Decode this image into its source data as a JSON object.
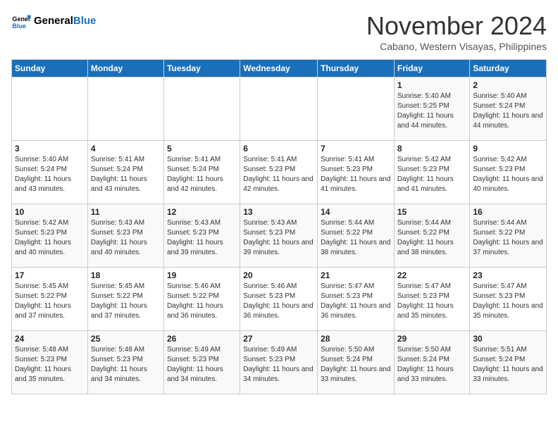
{
  "logo": {
    "line1": "General",
    "line2": "Blue"
  },
  "header": {
    "month": "November 2024",
    "location": "Cabano, Western Visayas, Philippines"
  },
  "weekdays": [
    "Sunday",
    "Monday",
    "Tuesday",
    "Wednesday",
    "Thursday",
    "Friday",
    "Saturday"
  ],
  "weeks": [
    [
      {
        "day": "",
        "info": ""
      },
      {
        "day": "",
        "info": ""
      },
      {
        "day": "",
        "info": ""
      },
      {
        "day": "",
        "info": ""
      },
      {
        "day": "",
        "info": ""
      },
      {
        "day": "1",
        "info": "Sunrise: 5:40 AM\nSunset: 5:25 PM\nDaylight: 11 hours and 44 minutes."
      },
      {
        "day": "2",
        "info": "Sunrise: 5:40 AM\nSunset: 5:24 PM\nDaylight: 11 hours and 44 minutes."
      }
    ],
    [
      {
        "day": "3",
        "info": "Sunrise: 5:40 AM\nSunset: 5:24 PM\nDaylight: 11 hours and 43 minutes."
      },
      {
        "day": "4",
        "info": "Sunrise: 5:41 AM\nSunset: 5:24 PM\nDaylight: 11 hours and 43 minutes."
      },
      {
        "day": "5",
        "info": "Sunrise: 5:41 AM\nSunset: 5:24 PM\nDaylight: 11 hours and 42 minutes."
      },
      {
        "day": "6",
        "info": "Sunrise: 5:41 AM\nSunset: 5:23 PM\nDaylight: 11 hours and 42 minutes."
      },
      {
        "day": "7",
        "info": "Sunrise: 5:41 AM\nSunset: 5:23 PM\nDaylight: 11 hours and 41 minutes."
      },
      {
        "day": "8",
        "info": "Sunrise: 5:42 AM\nSunset: 5:23 PM\nDaylight: 11 hours and 41 minutes."
      },
      {
        "day": "9",
        "info": "Sunrise: 5:42 AM\nSunset: 5:23 PM\nDaylight: 11 hours and 40 minutes."
      }
    ],
    [
      {
        "day": "10",
        "info": "Sunrise: 5:42 AM\nSunset: 5:23 PM\nDaylight: 11 hours and 40 minutes."
      },
      {
        "day": "11",
        "info": "Sunrise: 5:43 AM\nSunset: 5:23 PM\nDaylight: 11 hours and 40 minutes."
      },
      {
        "day": "12",
        "info": "Sunrise: 5:43 AM\nSunset: 5:23 PM\nDaylight: 11 hours and 39 minutes."
      },
      {
        "day": "13",
        "info": "Sunrise: 5:43 AM\nSunset: 5:23 PM\nDaylight: 11 hours and 39 minutes."
      },
      {
        "day": "14",
        "info": "Sunrise: 5:44 AM\nSunset: 5:22 PM\nDaylight: 11 hours and 38 minutes."
      },
      {
        "day": "15",
        "info": "Sunrise: 5:44 AM\nSunset: 5:22 PM\nDaylight: 11 hours and 38 minutes."
      },
      {
        "day": "16",
        "info": "Sunrise: 5:44 AM\nSunset: 5:22 PM\nDaylight: 11 hours and 37 minutes."
      }
    ],
    [
      {
        "day": "17",
        "info": "Sunrise: 5:45 AM\nSunset: 5:22 PM\nDaylight: 11 hours and 37 minutes."
      },
      {
        "day": "18",
        "info": "Sunrise: 5:45 AM\nSunset: 5:22 PM\nDaylight: 11 hours and 37 minutes."
      },
      {
        "day": "19",
        "info": "Sunrise: 5:46 AM\nSunset: 5:22 PM\nDaylight: 11 hours and 36 minutes."
      },
      {
        "day": "20",
        "info": "Sunrise: 5:46 AM\nSunset: 5:23 PM\nDaylight: 11 hours and 36 minutes."
      },
      {
        "day": "21",
        "info": "Sunrise: 5:47 AM\nSunset: 5:23 PM\nDaylight: 11 hours and 36 minutes."
      },
      {
        "day": "22",
        "info": "Sunrise: 5:47 AM\nSunset: 5:23 PM\nDaylight: 11 hours and 35 minutes."
      },
      {
        "day": "23",
        "info": "Sunrise: 5:47 AM\nSunset: 5:23 PM\nDaylight: 11 hours and 35 minutes."
      }
    ],
    [
      {
        "day": "24",
        "info": "Sunrise: 5:48 AM\nSunset: 5:23 PM\nDaylight: 11 hours and 35 minutes."
      },
      {
        "day": "25",
        "info": "Sunrise: 5:48 AM\nSunset: 5:23 PM\nDaylight: 11 hours and 34 minutes."
      },
      {
        "day": "26",
        "info": "Sunrise: 5:49 AM\nSunset: 5:23 PM\nDaylight: 11 hours and 34 minutes."
      },
      {
        "day": "27",
        "info": "Sunrise: 5:49 AM\nSunset: 5:23 PM\nDaylight: 11 hours and 34 minutes."
      },
      {
        "day": "28",
        "info": "Sunrise: 5:50 AM\nSunset: 5:24 PM\nDaylight: 11 hours and 33 minutes."
      },
      {
        "day": "29",
        "info": "Sunrise: 5:50 AM\nSunset: 5:24 PM\nDaylight: 11 hours and 33 minutes."
      },
      {
        "day": "30",
        "info": "Sunrise: 5:51 AM\nSunset: 5:24 PM\nDaylight: 11 hours and 33 minutes."
      }
    ]
  ]
}
